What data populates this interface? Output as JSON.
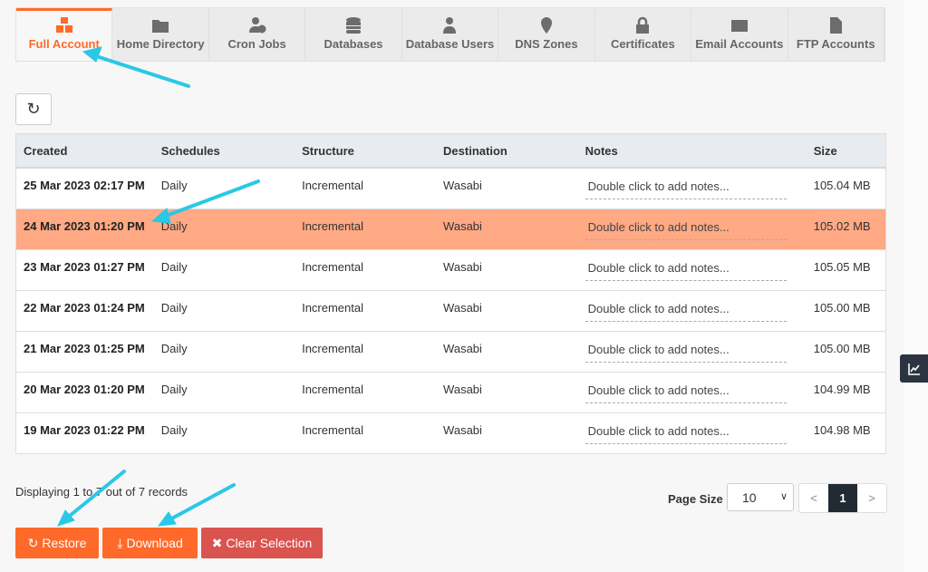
{
  "tabs": [
    {
      "label": "Full Account",
      "icon": "cubes-icon",
      "active": true
    },
    {
      "label": "Home Directory",
      "icon": "folder-icon"
    },
    {
      "label": "Cron Jobs",
      "icon": "user-clock-icon"
    },
    {
      "label": "Databases",
      "icon": "database-icon"
    },
    {
      "label": "Database Users",
      "icon": "user-tie-icon"
    },
    {
      "label": "DNS Zones",
      "icon": "map-marker-icon"
    },
    {
      "label": "Certificates",
      "icon": "lock-icon"
    },
    {
      "label": "Email Accounts",
      "icon": "envelope-icon"
    },
    {
      "label": "FTP Accounts",
      "icon": "file-icon"
    }
  ],
  "table": {
    "headers": [
      "Created",
      "Schedules",
      "Structure",
      "Destination",
      "Notes",
      "Size"
    ],
    "rows": [
      {
        "created": "25 Mar 2023 02:17 PM",
        "schedule": "Daily",
        "structure": "Incremental",
        "destination": "Wasabi",
        "notes": "Double click to add notes...",
        "size": "105.04 MB"
      },
      {
        "created": "24 Mar 2023 01:20 PM",
        "schedule": "Daily",
        "structure": "Incremental",
        "destination": "Wasabi",
        "notes": "Double click to add notes...",
        "size": "105.02 MB",
        "selected": true
      },
      {
        "created": "23 Mar 2023 01:27 PM",
        "schedule": "Daily",
        "structure": "Incremental",
        "destination": "Wasabi",
        "notes": "Double click to add notes...",
        "size": "105.05 MB"
      },
      {
        "created": "22 Mar 2023 01:24 PM",
        "schedule": "Daily",
        "structure": "Incremental",
        "destination": "Wasabi",
        "notes": "Double click to add notes...",
        "size": "105.00 MB"
      },
      {
        "created": "21 Mar 2023 01:25 PM",
        "schedule": "Daily",
        "structure": "Incremental",
        "destination": "Wasabi",
        "notes": "Double click to add notes...",
        "size": "105.00 MB"
      },
      {
        "created": "20 Mar 2023 01:20 PM",
        "schedule": "Daily",
        "structure": "Incremental",
        "destination": "Wasabi",
        "notes": "Double click to add notes...",
        "size": "104.99 MB"
      },
      {
        "created": "19 Mar 2023 01:22 PM",
        "schedule": "Daily",
        "structure": "Incremental",
        "destination": "Wasabi",
        "notes": "Double click to add notes...",
        "size": "104.98 MB"
      }
    ]
  },
  "footer": {
    "info": "Displaying 1 to 7 out of 7 records",
    "page_size_label": "Page Size",
    "page_size": "10",
    "prev": "<",
    "page": "1",
    "next": ">"
  },
  "buttons": {
    "restore": "Restore",
    "download": "Download",
    "clear": "Clear Selection"
  },
  "colors": {
    "accent": "#ff6a2a",
    "selected_row": "#ffa985",
    "danger": "#d9534f",
    "annotation": "#29c8e6"
  }
}
